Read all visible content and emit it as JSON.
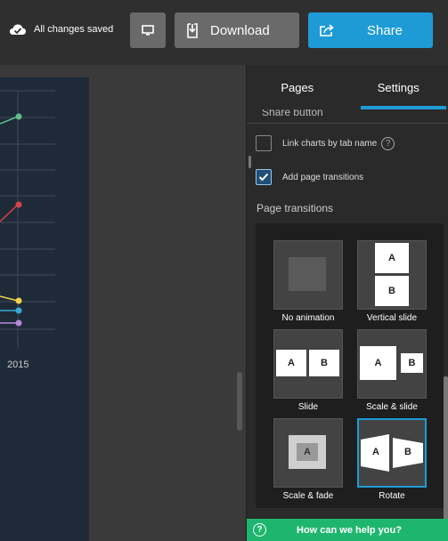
{
  "topbar": {
    "saved_text": "All changes saved",
    "download_label": "Download",
    "share_label": "Share"
  },
  "chart_preview": {
    "x_tick": "2015",
    "point_colors": [
      "#5fbf8a",
      "#d9434e",
      "#f1d14a",
      "#3aa9d6",
      "#b48ad6"
    ]
  },
  "panel": {
    "tabs": [
      {
        "label": "Pages"
      },
      {
        "label": "Settings"
      }
    ],
    "cut_label": "Share button",
    "options": {
      "link_charts": {
        "label": "Link charts by tab name",
        "checked": false
      },
      "page_transitions": {
        "label": "Add page transitions",
        "checked": true
      }
    },
    "section_title": "Page transitions",
    "transitions": [
      {
        "label": "No animation",
        "icon": "no-animation-icon"
      },
      {
        "label": "Vertical slide",
        "icon": "vertical-slide-icon",
        "card_a": "A",
        "card_b": "B"
      },
      {
        "label": "Slide",
        "icon": "slide-icon",
        "card_a": "A",
        "card_b": "B"
      },
      {
        "label": "Scale & slide",
        "icon": "scale-slide-icon",
        "card_a": "A",
        "card_b": "B"
      },
      {
        "label": "Scale & fade",
        "icon": "scale-fade-icon",
        "card_a": "A"
      },
      {
        "label": "Rotate",
        "icon": "rotate-icon",
        "card_a": "A",
        "card_b": "B",
        "selected": true
      }
    ],
    "help": "How can we help you?"
  },
  "colors": {
    "accent": "#1e9bd7",
    "help_green": "#1eb66e",
    "chart_bg": "#1f2a38"
  }
}
